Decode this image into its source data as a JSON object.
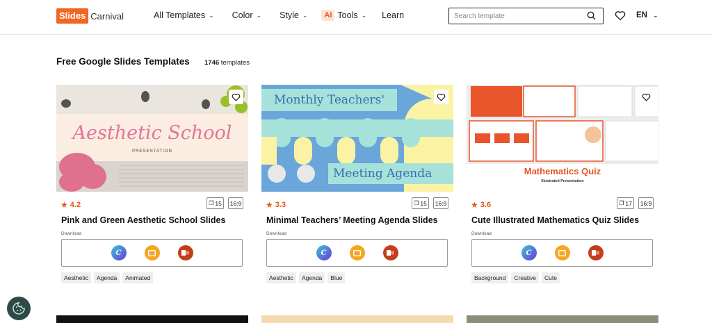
{
  "header": {
    "logo_box": "Slides",
    "logo_text": "Carnival",
    "nav": [
      {
        "label": "All Templates"
      },
      {
        "label": "Color"
      },
      {
        "label": "Style"
      },
      {
        "label": "Tools",
        "badge": "AI"
      },
      {
        "label": "Learn"
      }
    ],
    "search_placeholder": "Search template",
    "language": "EN",
    "icons": [
      "search-icon",
      "heart-icon",
      "chevron-down-icon"
    ]
  },
  "main": {
    "title": "Free Google Slides Templates",
    "count_number": "1746",
    "count_label": "templates"
  },
  "cards": [
    {
      "thumb_title": "Aesthetic School",
      "thumb_subtitle": "PRESENTATION",
      "rating": "4.2",
      "slides": "15",
      "ratio": "16:9",
      "title": "Pink and Green Aesthetic School Slides",
      "download_label": "Download",
      "tags": [
        "Aesthetic",
        "Agenda",
        "Animated"
      ]
    },
    {
      "thumb_title": "Monthly Teachers'",
      "thumb_subtitle": "Meeting Agenda",
      "rating": "3.3",
      "slides": "15",
      "ratio": "16:9",
      "title": "Minimal Teachers’ Meeting Agenda Slides",
      "download_label": "Download",
      "tags": [
        "Aesthetic",
        "Agenda",
        "Blue"
      ]
    },
    {
      "thumb_title": "Mathematics Quiz",
      "thumb_subtitle": "Illustrated Presentation",
      "rating": "3.6",
      "slides": "17",
      "ratio": "16:9",
      "title": "Cute Illustrated Mathematics Quiz Slides",
      "download_label": "Download",
      "tags": [
        "Background",
        "Creative",
        "Cute"
      ]
    }
  ],
  "colors": {
    "brand": "#f26522",
    "rating": "#e2571e",
    "canva": "#6a3bd8",
    "google_slides": "#f5a623",
    "powerpoint": "#c43e1c"
  }
}
